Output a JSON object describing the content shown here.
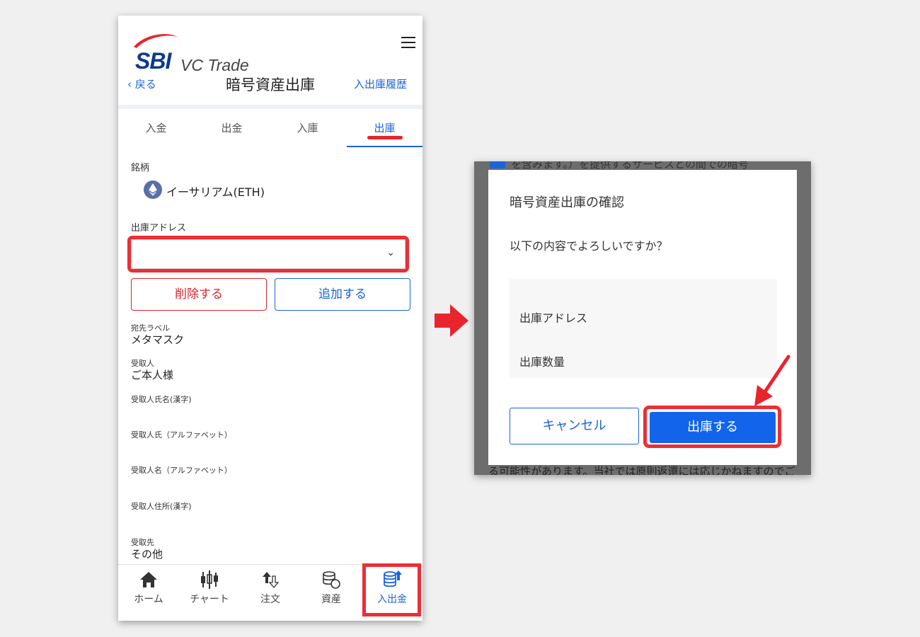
{
  "phone": {
    "logo": {
      "brand": "SBI",
      "sub": "VC Trade"
    },
    "header": {
      "back": "‹ 戻る",
      "title": "暗号資産出庫",
      "history": "入出庫履歴"
    },
    "tabs": [
      "入金",
      "出金",
      "入庫",
      "出庫"
    ],
    "active_tab": "出庫",
    "brand_label": "銘柄",
    "brand_value": "イーサリアム(ETH)",
    "address_label": "出庫アドレス",
    "address_value": "",
    "select_chevron": "⌄",
    "buttons": {
      "delete": "削除する",
      "add": "追加する"
    },
    "info": [
      {
        "label": "宛先ラベル",
        "value": "メタマスク"
      },
      {
        "label": "受取人",
        "value": "ご本人様"
      },
      {
        "label": "受取人氏名(漢字)",
        "value": ""
      },
      {
        "label": "受取人氏（アルファベット）",
        "value": ""
      },
      {
        "label": "受取人名（アルファベット）",
        "value": ""
      },
      {
        "label": "受取人住所(漢字)",
        "value": ""
      },
      {
        "label": "受取先",
        "value": "その他"
      }
    ],
    "nav": [
      {
        "label": "ホーム",
        "icon": "home-icon"
      },
      {
        "label": "チャート",
        "icon": "candlestick-chart-icon"
      },
      {
        "label": "注文",
        "icon": "order-arrows-icon"
      },
      {
        "label": "資産",
        "icon": "coins-icon"
      },
      {
        "label": "入出金",
        "icon": "deposit-withdraw-icon"
      }
    ],
    "active_nav": "入出金"
  },
  "dialog": {
    "bg_top_text": "を含みます。）を提供するサービスとの間での暗号",
    "bg_bottom_text": "る可能性があります。当社では原則返還には応じかねますのでご",
    "title": "暗号資産出庫の確認",
    "question": "以下の内容でよろしいですか？",
    "rows": [
      "出庫アドレス",
      "出庫数量"
    ],
    "cancel": "キャンセル",
    "confirm": "出庫する"
  },
  "colors": {
    "accent_blue": "#1b64d9",
    "confirm_blue": "#1264eb",
    "highlight_red": "#ed2e35",
    "delete_red": "#d8262d"
  }
}
